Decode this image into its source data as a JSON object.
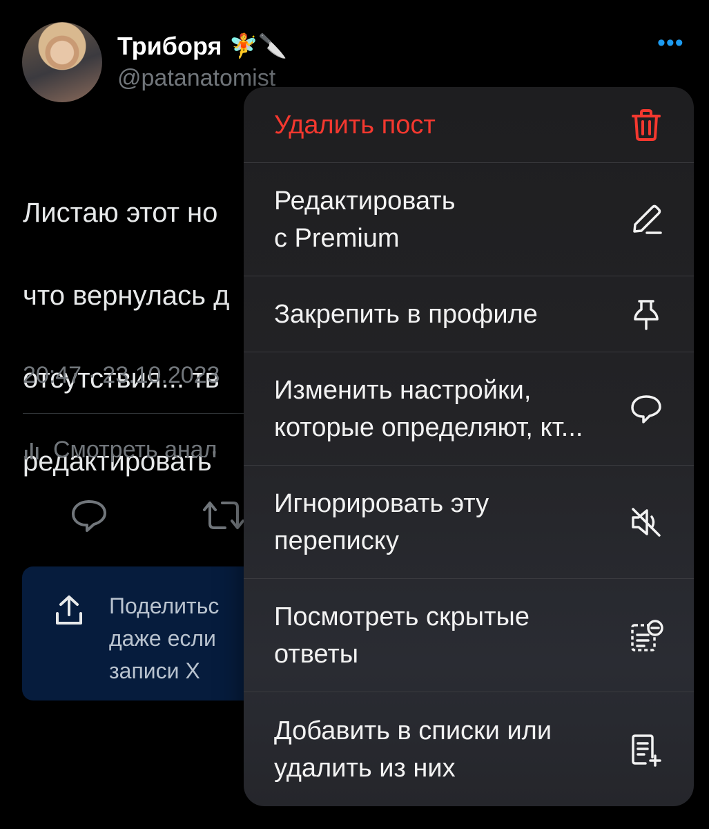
{
  "tweet": {
    "display_name": "Триборя",
    "name_emojis": "🧚🔪",
    "handle": "@patanatomist",
    "more_label": "•••",
    "text_lines": [
      "Листаю этот но",
      "что вернулась д",
      "отсутствия... тв",
      "редактировать'"
    ],
    "time": "20:47 · 23.10.2023 ",
    "analytics_label": "Смотреть анал"
  },
  "share_card": {
    "text": "Поделитьс\nдаже если \nзаписи X"
  },
  "menu": {
    "items": [
      {
        "label": "Удалить пост",
        "icon": "trash-icon"
      },
      {
        "label": "Редактировать\nс Premium",
        "icon": "pencil-icon"
      },
      {
        "label": "Закрепить в профиле",
        "icon": "pin-icon"
      },
      {
        "label": "Изменить настройки,\nкоторые определяют, кт...",
        "icon": "speech-bubble-icon"
      },
      {
        "label": "Игнорировать эту\nпереписку",
        "icon": "mute-icon"
      },
      {
        "label": "Посмотреть скрытые\nответы",
        "icon": "hidden-replies-icon"
      },
      {
        "label": "Добавить в списки или\nудалить из них",
        "icon": "add-to-list-icon"
      }
    ]
  },
  "colors": {
    "danger": "#f4382f",
    "accent": "#1d9bf0",
    "muted": "#71767b"
  }
}
